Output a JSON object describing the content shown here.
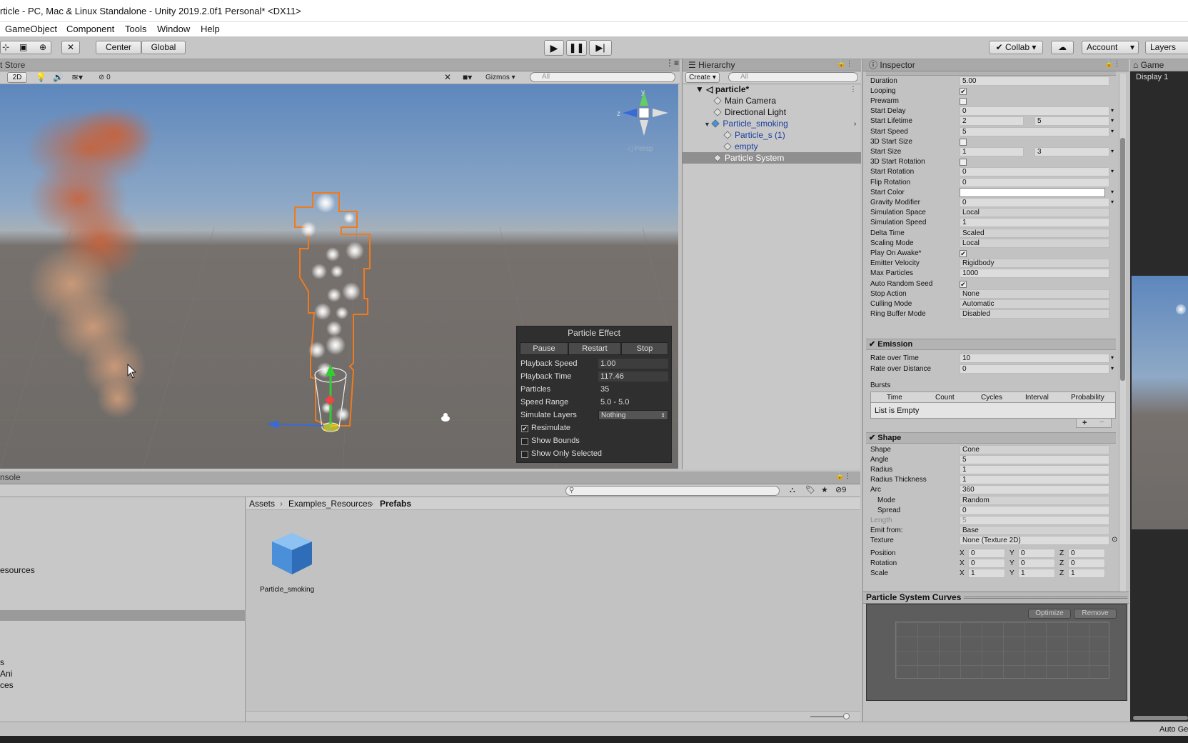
{
  "window": {
    "title": "rticle - PC, Mac & Linux Standalone - Unity 2019.2.0f1 Personal* <DX11>"
  },
  "menu": [
    "GameObject",
    "Component",
    "Tools",
    "Window",
    "Help"
  ],
  "toolbar": {
    "center": "Center",
    "global": "Global",
    "collab": "Collab",
    "account": "Account",
    "layers": "Layers"
  },
  "scene": {
    "tab": "t Store",
    "twod": "2D",
    "hidden_count": "0",
    "gizmos": "Gizmos",
    "search_placeholder": "All",
    "persp": "◁ Persp",
    "axis_y": "y",
    "axis_z": "z"
  },
  "particle_effect": {
    "title": "Particle Effect",
    "pause": "Pause",
    "restart": "Restart",
    "stop": "Stop",
    "rows": [
      {
        "label": "Playback Speed",
        "value": "1.00"
      },
      {
        "label": "Playback Time",
        "value": "117.46"
      },
      {
        "label": "Particles",
        "value": "35"
      },
      {
        "label": "Speed Range",
        "value": "5.0 - 5.0"
      },
      {
        "label": "Simulate Layers",
        "value": "Nothing"
      }
    ],
    "checks": [
      {
        "label": "Resimulate",
        "checked": true
      },
      {
        "label": "Show Bounds",
        "checked": false
      },
      {
        "label": "Show Only Selected",
        "checked": false
      }
    ]
  },
  "hierarchy": {
    "tab": "Hierarchy",
    "create": "Create",
    "search_placeholder": "All",
    "scene": "particle*",
    "items": [
      "Main Camera",
      "Directional Light",
      "Particle_smoking",
      "Particle_s (1)",
      "empty",
      "Particle System"
    ]
  },
  "inspector": {
    "tab": "Inspector",
    "main": [
      {
        "label": "Duration",
        "value": "5.00"
      },
      {
        "label": "Looping",
        "check": true
      },
      {
        "label": "Prewarm",
        "check": false
      },
      {
        "label": "Start Delay",
        "value": "0",
        "dd": true
      },
      {
        "label": "Start Lifetime",
        "value": "2",
        "value2": "5",
        "dd": true
      },
      {
        "label": "Start Speed",
        "value": "5",
        "dd": true
      },
      {
        "label": "3D Start Size",
        "check": false
      },
      {
        "label": "Start Size",
        "value": "1",
        "value2": "3",
        "dd": true
      },
      {
        "label": "3D Start Rotation",
        "check": false
      },
      {
        "label": "Start Rotation",
        "value": "0",
        "dd": true
      },
      {
        "label": "Flip Rotation",
        "value": "0"
      },
      {
        "label": "Start Color",
        "color": true,
        "dd": true
      },
      {
        "label": "Gravity Modifier",
        "value": "0",
        "dd": true
      },
      {
        "label": "Simulation Space",
        "value": "Local",
        "sel": true
      },
      {
        "label": "Simulation Speed",
        "value": "1"
      },
      {
        "label": "Delta Time",
        "value": "Scaled",
        "sel": true
      },
      {
        "label": "Scaling Mode",
        "value": "Local",
        "sel": true
      },
      {
        "label": "Play On Awake*",
        "check": true
      },
      {
        "label": "Emitter Velocity",
        "value": "Rigidbody",
        "sel": true
      },
      {
        "label": "Max Particles",
        "value": "1000"
      },
      {
        "label": "Auto Random Seed",
        "check": true
      },
      {
        "label": "Stop Action",
        "value": "None",
        "sel": true
      },
      {
        "label": "Culling Mode",
        "value": "Automatic",
        "sel": true
      },
      {
        "label": "Ring Buffer Mode",
        "value": "Disabled",
        "sel": true
      }
    ],
    "emission": {
      "title": "Emission",
      "rate_time_label": "Rate over Time",
      "rate_time": "10",
      "rate_dist_label": "Rate over Distance",
      "rate_dist": "0",
      "bursts_label": "Bursts",
      "columns": [
        "Time",
        "Count",
        "Cycles",
        "Interval",
        "Probability"
      ],
      "empty": "List is Empty"
    },
    "shape": {
      "title": "Shape",
      "rows": [
        {
          "label": "Shape",
          "value": "Cone",
          "sel": true
        },
        {
          "label": "Angle",
          "value": "5"
        },
        {
          "label": "Radius",
          "value": "1"
        },
        {
          "label": "Radius Thickness",
          "value": "1"
        },
        {
          "label": "Arc",
          "value": "360"
        },
        {
          "label": "Mode",
          "value": "Random",
          "sel": true,
          "indent": true
        },
        {
          "label": "Spread",
          "value": "0",
          "indent": true
        },
        {
          "label": "Length",
          "value": "5",
          "disabled": true
        },
        {
          "label": "Emit from:",
          "value": "Base",
          "sel": true
        },
        {
          "label": "Texture",
          "value": "None (Texture 2D)"
        }
      ],
      "transform": [
        {
          "label": "Position",
          "x": "0",
          "y": "0",
          "z": "0"
        },
        {
          "label": "Rotation",
          "x": "0",
          "y": "0",
          "z": "0"
        },
        {
          "label": "Scale",
          "x": "1",
          "y": "1",
          "z": "1"
        }
      ]
    },
    "curves": {
      "title": "Particle System Curves",
      "optimize": "Optimize",
      "remove": "Remove"
    }
  },
  "game": {
    "tab": "Game",
    "display": "Display 1"
  },
  "console": {
    "tab": "nsole"
  },
  "project": {
    "breadcrumb": [
      "Assets",
      "Examples_Resources",
      "Prefabs"
    ],
    "asset": "Particle_smoking",
    "count": "9",
    "tree": [
      "esources",
      "s",
      "Ani",
      "ces"
    ]
  },
  "status": {
    "right": "Auto Ge"
  },
  "colors": {
    "selection_orange": "#f07a1e",
    "prefab_blue": "#1a3fa0",
    "cube_blue": "#4a8fd8"
  }
}
